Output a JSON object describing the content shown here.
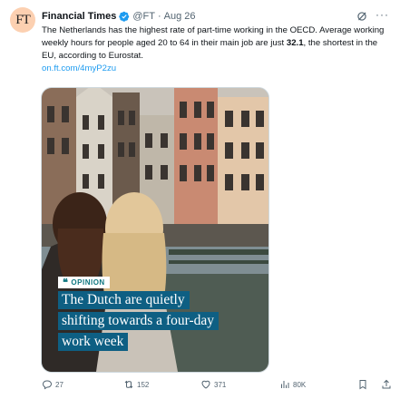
{
  "tweet": {
    "avatar_text": "FT",
    "author_name": "Financial Times",
    "handle": "@FT",
    "separator": "·",
    "date": "Aug 26",
    "text_before_bold": "The Netherlands has the highest rate of part-time working in the OECD. Average working weekly hours for people aged 20 to 64 in their main job are just ",
    "text_bold": "32.1",
    "text_after_bold": ", the shortest in the EU, according to Eurostat.",
    "link": "on.ft.com/4myP2zu"
  },
  "card": {
    "badge_quote": "❝",
    "badge": "OPINION",
    "headline_lines": [
      "The Dutch are quietly",
      "shifting towards a four-day",
      "work week"
    ]
  },
  "actions": {
    "replies": "27",
    "reposts": "152",
    "likes": "371",
    "views": "80K"
  },
  "colors": {
    "link": "#1d9bf0",
    "verified": "#1d9bf0",
    "headline_bg": "#0e5f83",
    "opinion_text": "#0d7680",
    "avatar_bg": "#fcd0b1"
  }
}
